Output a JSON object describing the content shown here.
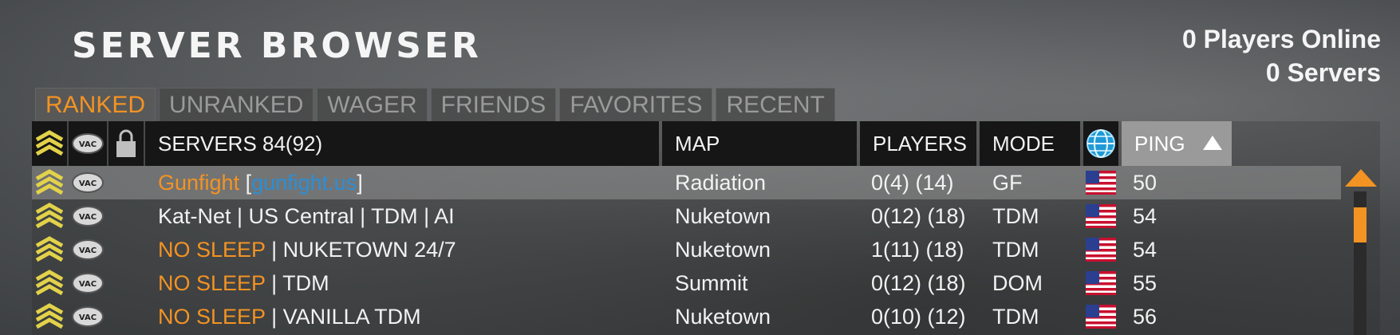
{
  "title": "SERVER BROWSER",
  "stats": {
    "players_online": "0 Players Online",
    "servers": "0 Servers"
  },
  "tabs": [
    "RANKED",
    "UNRANKED",
    "WAGER",
    "FRIENDS",
    "FAVORITES",
    "RECENT"
  ],
  "active_tab": "RANKED",
  "columns": {
    "rank_icon": "rank-chevron-icon",
    "vac_icon": "vac-icon",
    "lock_icon": "lock-icon",
    "servers": "SERVERS 84(92)",
    "map": "MAP",
    "players": "PLAYERS",
    "mode": "MODE",
    "region_icon": "globe-icon",
    "ping": "PING"
  },
  "sort": {
    "column": "PING",
    "direction": "ascending"
  },
  "rows": [
    {
      "name_parts": [
        "Gunfight",
        " [",
        "gunfight.us",
        "]"
      ],
      "map": "Radiation",
      "players": "0(4) (14)",
      "mode": "GF",
      "region": "us-flag-icon",
      "ping": "50",
      "selected": true
    },
    {
      "name_parts": [
        "",
        "Kat-Net | US Central | TDM | AI",
        "",
        ""
      ],
      "map": "Nuketown",
      "players": "0(12) (18)",
      "mode": "TDM",
      "region": "us-flag-icon",
      "ping": "54",
      "selected": false
    },
    {
      "name_parts": [
        "NO SLEEP",
        " | NUKETOWN 24/7",
        "",
        ""
      ],
      "map": "Nuketown",
      "players": "1(11) (18)",
      "mode": "TDM",
      "region": "us-flag-icon",
      "ping": "54",
      "selected": false
    },
    {
      "name_parts": [
        "NO SLEEP",
        " | TDM",
        "",
        ""
      ],
      "map": "Summit",
      "players": "0(12) (18)",
      "mode": "DOM",
      "region": "us-flag-icon",
      "ping": "55",
      "selected": false
    },
    {
      "name_parts": [
        "NO SLEEP",
        " | VANILLA TDM",
        "",
        ""
      ],
      "map": "Nuketown",
      "players": "0(10) (12)",
      "mode": "TDM",
      "region": "us-flag-icon",
      "ping": "56",
      "selected": false
    }
  ],
  "colors": {
    "accent": "#f39323",
    "link": "#2a8fd8",
    "header_bg": "#161616",
    "sorted_header_bg": "#9a9a9a"
  }
}
